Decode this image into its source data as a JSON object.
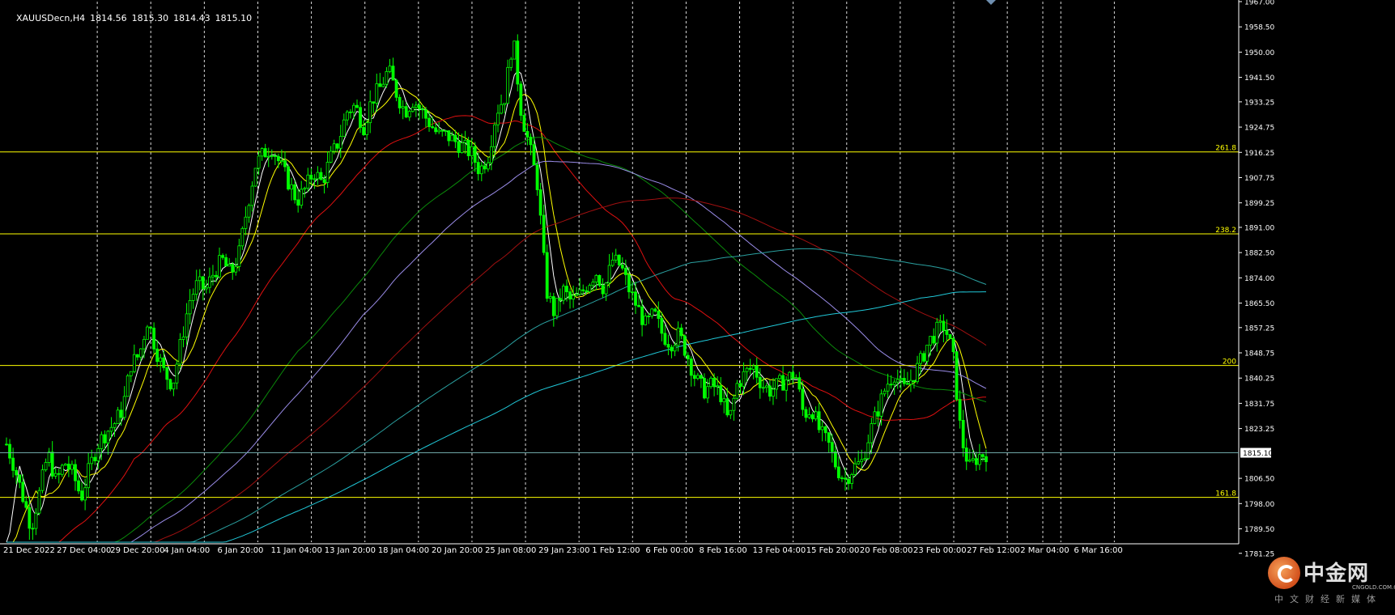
{
  "header": {
    "symbol": "XAUUSDecn,H4",
    "open": "1814.56",
    "high": "1815.30",
    "low": "1814.43",
    "close": "1815.10"
  },
  "colors": {
    "background": "#000000",
    "candle": "#00ff00",
    "grid": "#ffffff",
    "fib_line": "#ffff00",
    "price_line": "#6fa7a7",
    "axis_text": "#ffffff",
    "ma_white": "#ffffff",
    "ma_yellow": "#ffff00",
    "ma_red": "#e01010",
    "ma_darkgreen": "#0a8a0a",
    "ma_violet": "#9a8ce8",
    "ma_darkred": "#a01010",
    "ma_teal": "#2aa0a0",
    "ma_cyan": "#20c8d8"
  },
  "chart_data": {
    "type": "candlestick",
    "symbol": "XAUUSDecn",
    "timeframe": "H4",
    "ylim": [
      1785.0,
      1967.0
    ],
    "y_ticks": [
      "1967.00",
      "1958.50",
      "1950.00",
      "1941.50",
      "1933.25",
      "1924.75",
      "1916.25",
      "1907.75",
      "1899.25",
      "1891.00",
      "1882.50",
      "1874.00",
      "1865.50",
      "1857.25",
      "1848.75",
      "1840.25",
      "1831.75",
      "1823.25",
      "1806.50",
      "1798.00",
      "1789.50",
      "1781.25"
    ],
    "current_price": "1815.10",
    "x_labels": [
      "21 Dec 2022",
      "27 Dec 04:00",
      "29 Dec 20:00",
      "4 Jan 04:00",
      "6 Jan 20:00",
      "11 Jan 04:00",
      "13 Jan 20:00",
      "18 Jan 04:00",
      "20 Jan 20:00",
      "25 Jan 08:00",
      "29 Jan 23:00",
      "1 Feb 12:00",
      "6 Feb 00:00",
      "8 Feb 16:00",
      "13 Feb 04:00",
      "15 Feb 20:00",
      "20 Feb 08:00",
      "23 Feb 00:00",
      "27 Feb 12:00",
      "2 Mar 04:00",
      "6 Mar 16:00"
    ],
    "grid": true,
    "fib_levels": [
      {
        "label": "261.8",
        "price": 1916.4
      },
      {
        "label": "238.2",
        "price": 1888.8
      },
      {
        "label": "200",
        "price": 1844.5
      },
      {
        "label": "161.8",
        "price": 1800.1
      }
    ],
    "close_path": [
      1818,
      1810,
      1800,
      1790,
      1802,
      1815,
      1805,
      1812,
      1808,
      1800,
      1810,
      1818,
      1822,
      1825,
      1830,
      1845,
      1848,
      1860,
      1850,
      1842,
      1838,
      1852,
      1866,
      1872,
      1870,
      1876,
      1880,
      1875,
      1882,
      1898,
      1912,
      1916,
      1918,
      1912,
      1906,
      1900,
      1904,
      1910,
      1906,
      1914,
      1920,
      1930,
      1932,
      1925,
      1934,
      1938,
      1944,
      1936,
      1930,
      1934,
      1930,
      1926,
      1922,
      1922,
      1920,
      1918,
      1916,
      1910,
      1915,
      1930,
      1935,
      1955,
      1930,
      1918,
      1905,
      1870,
      1862,
      1870,
      1866,
      1868,
      1872,
      1876,
      1870,
      1880,
      1878,
      1870,
      1864,
      1858,
      1862,
      1855,
      1852,
      1855,
      1848,
      1840,
      1836,
      1838,
      1835,
      1825,
      1838,
      1842,
      1844,
      1838,
      1836,
      1838,
      1840,
      1842,
      1828,
      1830,
      1822,
      1818,
      1810,
      1806,
      1810,
      1812,
      1822,
      1830,
      1838,
      1842,
      1836,
      1840,
      1845,
      1852,
      1856,
      1858,
      1848,
      1820,
      1810,
      1814,
      1815
    ]
  },
  "logo": {
    "brand_cn": "中金网",
    "brand_en": "CNGOLD.COM.CN",
    "tagline": "中文财经新媒体"
  }
}
